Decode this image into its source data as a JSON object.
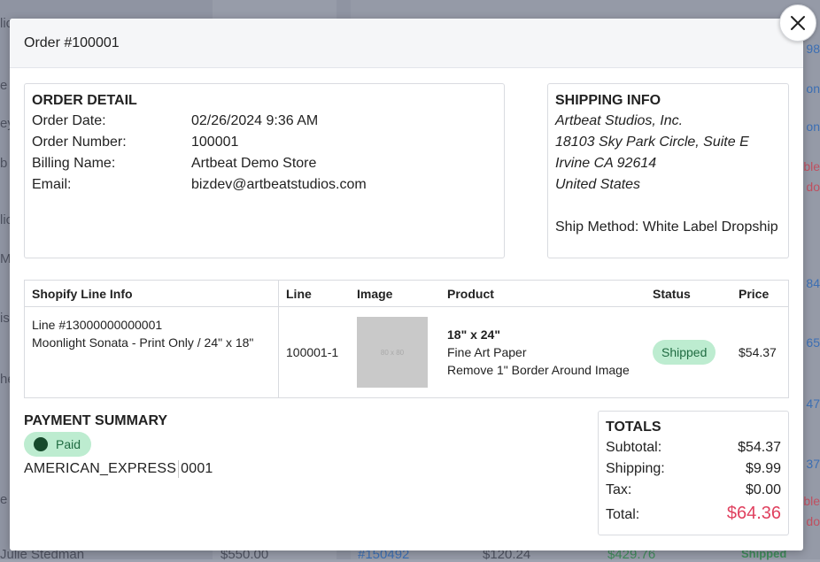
{
  "modal": {
    "title": "Order #100001",
    "close_label": "×"
  },
  "order_detail": {
    "heading": "ORDER DETAIL",
    "rows": [
      {
        "label": "Order Date:",
        "value": "02/26/2024 9:36 AM"
      },
      {
        "label": "Order Number:",
        "value": "100001"
      },
      {
        "label": "Billing Name:",
        "value": "Artbeat Demo Store"
      },
      {
        "label": "Email:",
        "value": "bizdev@artbeatstudios.com"
      }
    ]
  },
  "shipping_info": {
    "heading": "SHIPPING INFO",
    "company": "Artbeat Studios, Inc.",
    "street": "18103 Sky Park Circle, Suite E",
    "city": "Irvine CA 92614",
    "country": "United States",
    "ship_method": "Ship Method: White Label Dropship"
  },
  "line_items": {
    "headers": [
      "Shopify Line Info",
      "Line",
      "Image",
      "Product",
      "Status",
      "Price"
    ],
    "rows": [
      {
        "line_info_id": "Line #13000000000001",
        "line_info_desc": "Moonlight Sonata - Print Only / 24\" x 18\"",
        "line": "100001-1",
        "image_placeholder": "80 x 80",
        "product_size": "18\" x 24\"",
        "product_paper": "Fine Art Paper",
        "product_border": "Remove 1\" Border Around Image",
        "status": "Shipped",
        "price": "$54.37"
      }
    ]
  },
  "payment_summary": {
    "heading": "PAYMENT SUMMARY",
    "status": "Paid",
    "card_type": "AMERICAN_EXPRESS",
    "card_last4": "0001"
  },
  "totals": {
    "heading": "TOTALS",
    "subtotal_label": "Subtotal:",
    "subtotal": "$54.37",
    "shipping_label": "Shipping:",
    "shipping": "$9.99",
    "tax_label": "Tax:",
    "tax": "$0.00",
    "total_label": "Total:",
    "total": "$64.36"
  },
  "background": {
    "bottom_left_name": "Julie Stedman",
    "bottom_amount_1": "$550.00",
    "bottom_order_link": "#150492",
    "bottom_amount_2": "$120.24",
    "bottom_amount_3": "$429.76",
    "bottom_status": "Shipped",
    "right_fragments": [
      "98",
      "on",
      "on",
      "ble",
      "do",
      "84",
      "65",
      "47",
      "37",
      "ble",
      "do"
    ],
    "left_fragments": [
      "lic",
      "e I",
      "ey",
      "b",
      "lic",
      "M",
      "is",
      "he",
      "e I"
    ]
  },
  "colors": {
    "accent_total": "#e0415f",
    "status_green_bg": "#bdecd0",
    "status_green_text": "#1f6b41"
  }
}
